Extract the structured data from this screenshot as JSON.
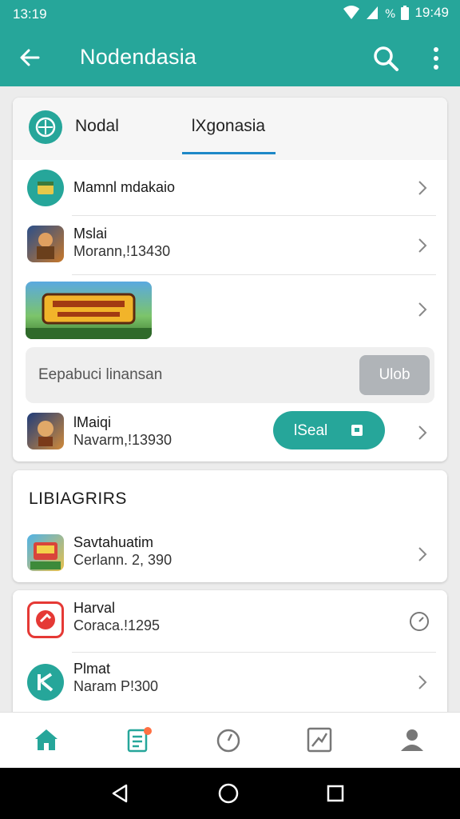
{
  "status_bar": {
    "time_left": "13:19",
    "time_right": "19:49"
  },
  "app_bar": {
    "title": "Nodendasia"
  },
  "tabs": {
    "tab1": "Nodal",
    "tab2": "lXgonasia"
  },
  "main_list": [
    {
      "line1": "Mamnl mdakaio",
      "line2": ""
    },
    {
      "line1": "Mslai",
      "line2": "Morann,!13430"
    }
  ],
  "input": {
    "value": "Eepabuci linansan",
    "button": "Ulob"
  },
  "user_row": {
    "line1": "lMaiqi",
    "line2": "Navarm,!13930",
    "pill_label": "lSeal"
  },
  "section2": {
    "title": "LIBIAGRIRS",
    "item": {
      "line1": "Savtahuatim",
      "line2": "Cerlann. 2, 390"
    }
  },
  "section3": [
    {
      "line1": "Harval",
      "line2": "Coraca.!1295"
    },
    {
      "line1": "Plmat",
      "line2": "Naram P!300"
    }
  ],
  "colors": {
    "primary": "#26a69a",
    "accent_blue": "#1e88c7",
    "badge": "#ff7043"
  },
  "icons": [
    "back-arrow-icon",
    "search-icon",
    "more-vert-icon",
    "compass-icon",
    "chevron-right-icon",
    "clock-icon",
    "home-icon",
    "list-icon",
    "timer-icon",
    "chart-icon",
    "profile-icon"
  ]
}
